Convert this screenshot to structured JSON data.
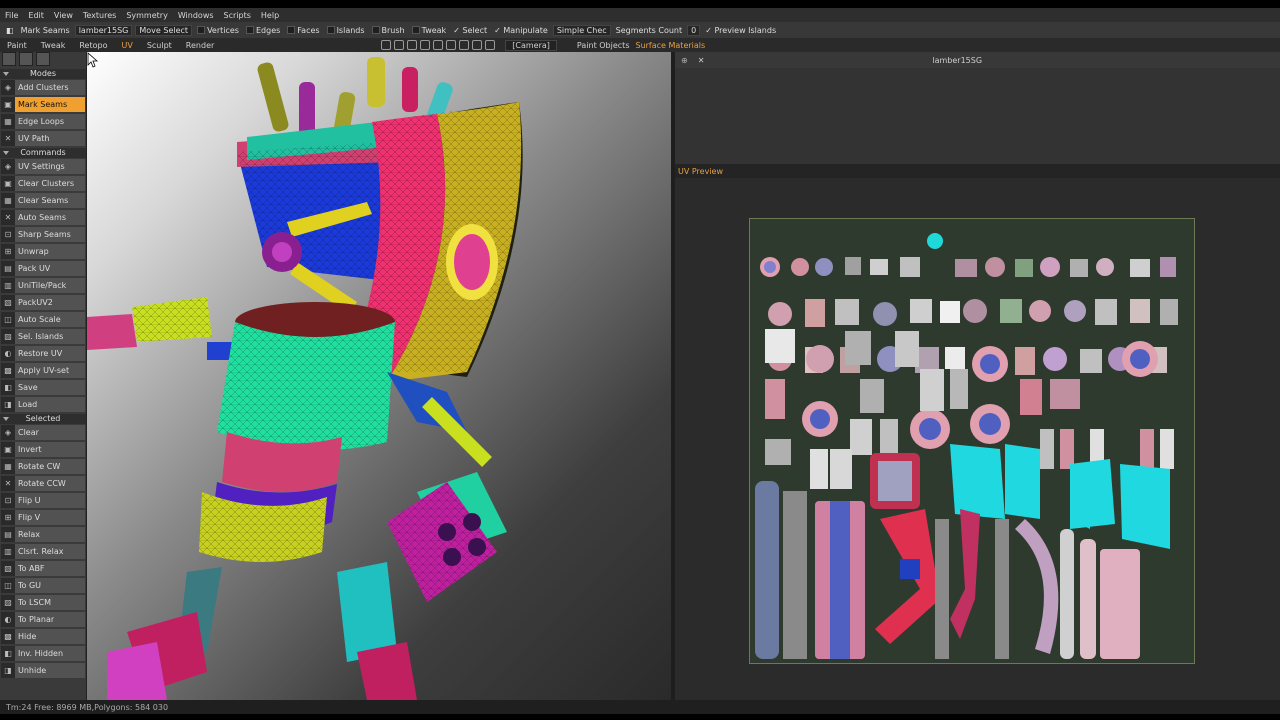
{
  "menubar": [
    "File",
    "Edit",
    "View",
    "Textures",
    "Symmetry",
    "Windows",
    "Scripts",
    "Help"
  ],
  "toolbar": {
    "mode": "Mark Seams",
    "object": "lamber15SG",
    "move": "Move",
    "select": "Select",
    "vertices": "Vertices",
    "edges": "Edges",
    "faces": "Faces",
    "islands": "Islands",
    "brush": "Brush",
    "tweak": "Tweak",
    "select_chk": "Select",
    "manipulate": "Manipulate",
    "checker": "Simple Chec",
    "segments": "Segments Count",
    "segments_value": "0",
    "preview_islands": "Preview Islands"
  },
  "rooms": [
    "Paint",
    "Tweak",
    "Retopo",
    "UV",
    "Sculpt",
    "Render"
  ],
  "active_room": "UV",
  "camera": "[Camera]",
  "right_tabs": [
    "Paint Objects",
    "Surface Materials"
  ],
  "left_panel": {
    "modes_header": "Modes",
    "modes": [
      {
        "label": "Add Clusters",
        "active": false
      },
      {
        "label": "Mark Seams",
        "active": true
      },
      {
        "label": "Edge Loops",
        "active": false
      },
      {
        "label": "UV Path",
        "active": false
      }
    ],
    "commands_header": "Commands",
    "commands": [
      "UV Settings",
      "Clear Clusters",
      "Clear Seams",
      "Auto Seams",
      "Sharp Seams",
      "Unwrap",
      "Pack UV",
      "UniTile/Pack",
      "PackUV2",
      "Auto Scale",
      "Sel. Islands",
      "Restore UV",
      "Apply UV-set",
      "Save",
      "Load"
    ],
    "selected_header": "Selected",
    "selected": [
      "Clear",
      "Invert",
      "Rotate CW",
      "Rotate CCW",
      "Flip U",
      "Flip V",
      "Relax",
      "Clsrt. Relax",
      "To ABF",
      "To GU",
      "To LSCM",
      "To Planar",
      "Hide",
      "Inv. Hidden",
      "Unhide"
    ]
  },
  "right_panel": {
    "title": "lamber15SG",
    "uv_preview_label": "UV Preview"
  },
  "statusbar": {
    "text": "Tm:24 Free: 8969 MB,Polygons: 584 030"
  }
}
